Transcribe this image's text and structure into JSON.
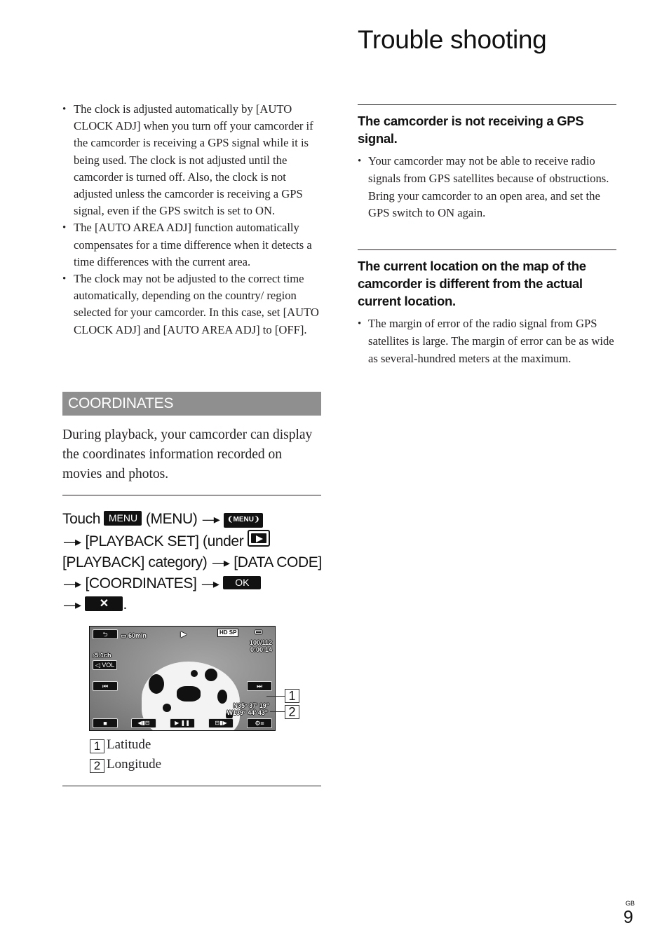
{
  "header": {
    "title": "Trouble shooting"
  },
  "left": {
    "bullets": [
      "The clock is adjusted automatically by [AUTO CLOCK ADJ] when you turn off your camcorder if the camcorder is receiving a GPS signal while it is being used. The clock is not adjusted until the camcorder is turned off. Also, the clock is not adjusted unless the camcorder is receiving a GPS signal, even if the GPS switch is set to ON.",
      "The [AUTO AREA ADJ] function automatically compensates for a time difference when it detects a time differences with the current area.",
      "The clock may not be adjusted to the correct time automatically, depending on the country/ region selected for your camcorder. In this case, set [AUTO CLOCK ADJ] and [AUTO AREA ADJ] to [OFF]."
    ],
    "section_title": "COORDINATES",
    "intro": "During playback, your camcorder can display the coordinates information recorded on movies and photos.",
    "steps": {
      "touch": "Touch",
      "menu_btn": "MENU",
      "menu_label": "(MENU)",
      "menu2_btn": "❨MENU❩",
      "arrow": "—▸",
      "playback_set": "[PLAYBACK SET] (under",
      "playback_category": "[PLAYBACK] category)",
      "data_code": "[DATA CODE]",
      "coordinates": "[COORDINATES]",
      "ok_btn": "OK",
      "close_btn": "✕",
      "period": "."
    },
    "screen": {
      "back_icon": "⮌",
      "battery": "60min",
      "play_icon": "▶",
      "quality": "HD SP",
      "media_icon": "▭",
      "counter": "100/112",
      "time": "0:00:14",
      "audio": "♪5.1ch",
      "vol_btn": "🔈VOL",
      "prev_btn": "⏮",
      "next_btn": "⏭",
      "latitude": "N35° 37' 19\"",
      "longitude": "W139° 44' 43\"",
      "stop_btn": "■",
      "rewind_btn": "◀▮⊟",
      "playpause_btn": "▶ ❚❚",
      "forward_btn": "⊟▮▶",
      "options_btn": "⚙≡"
    },
    "callouts": [
      "1",
      "2"
    ],
    "legend": [
      {
        "num": "1",
        "label": "Latitude"
      },
      {
        "num": "2",
        "label": "Longitude"
      }
    ]
  },
  "right": {
    "sections": [
      {
        "heading": "The camcorder is not receiving a GPS signal.",
        "bullets": [
          "Your camcorder may not be able to receive radio signals from GPS satellites because of obstructions. Bring your camcorder to an open area, and set the GPS switch to ON again."
        ]
      },
      {
        "heading": "The current location on the map of the camcorder is different from the actual current location.",
        "bullets": [
          "The margin of error of the radio signal from GPS satellites is large. The margin of error can be as wide as several-hundred meters at the maximum."
        ]
      }
    ]
  },
  "footer": {
    "region": "GB",
    "page": "9"
  }
}
